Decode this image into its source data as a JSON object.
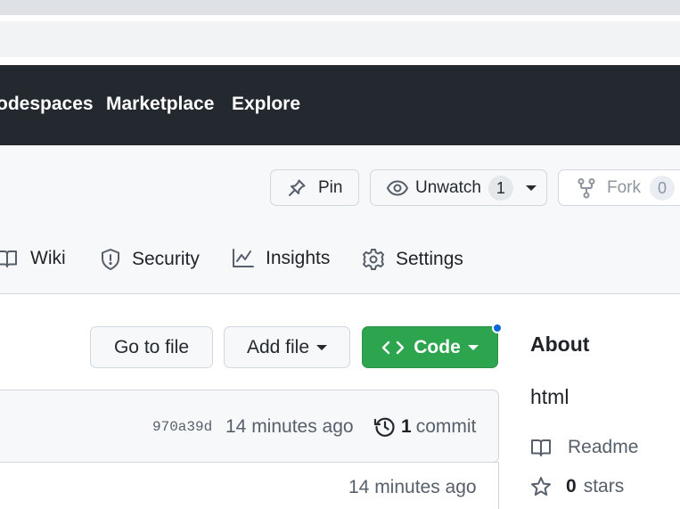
{
  "nav": {
    "items": [
      "odespaces",
      "Marketplace",
      "Explore"
    ]
  },
  "repo_actions": {
    "pin": "Pin",
    "watch": "Unwatch",
    "watch_count": "1",
    "fork": "Fork",
    "fork_count": "0"
  },
  "tabs": [
    "Wiki",
    "Security",
    "Insights",
    "Settings"
  ],
  "toolbar": {
    "go_to_file": "Go to file",
    "add_file": "Add file",
    "code": "Code"
  },
  "commit": {
    "hash": "970a39d",
    "time": "14 minutes ago",
    "count": "1",
    "label": "commit"
  },
  "file_row": {
    "time": "14 minutes ago"
  },
  "about": {
    "heading": "About",
    "description": "html",
    "readme": "Readme",
    "stars_count": "0",
    "stars_label": "stars"
  },
  "colors": {
    "nav_bg": "#24292f",
    "code_green": "#2da44e",
    "dot_blue": "#0969da"
  }
}
